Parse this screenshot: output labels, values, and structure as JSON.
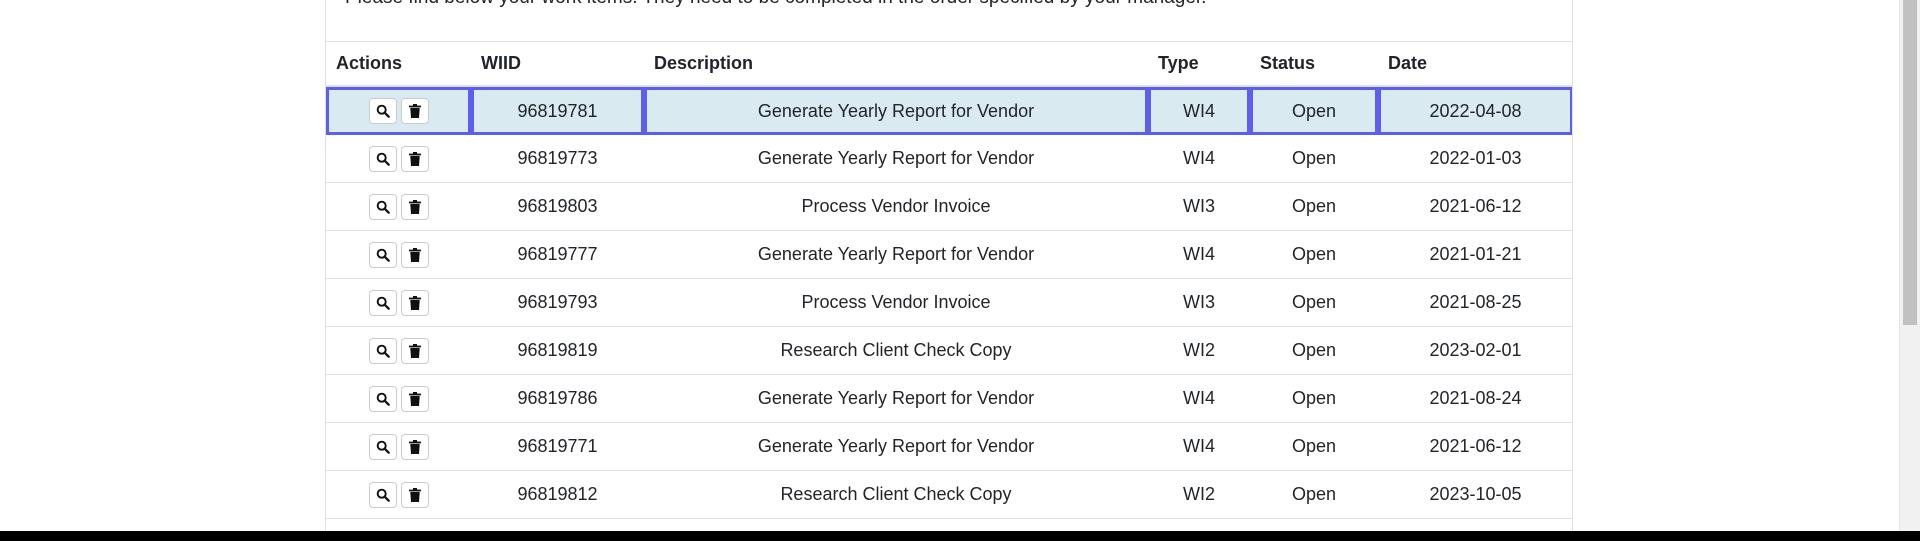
{
  "intro_text": "Please find below your work items. They need to be completed in the order specified by your manager.",
  "table": {
    "headers": {
      "actions": "Actions",
      "wiid": "WIID",
      "description": "Description",
      "type": "Type",
      "status": "Status",
      "date": "Date"
    },
    "rows": [
      {
        "wiid": "96819781",
        "description": "Generate Yearly Report for Vendor",
        "type": "WI4",
        "status": "Open",
        "date": "2022-04-08",
        "selected": true
      },
      {
        "wiid": "96819773",
        "description": "Generate Yearly Report for Vendor",
        "type": "WI4",
        "status": "Open",
        "date": "2022-01-03"
      },
      {
        "wiid": "96819803",
        "description": "Process Vendor Invoice",
        "type": "WI3",
        "status": "Open",
        "date": "2021-06-12"
      },
      {
        "wiid": "96819777",
        "description": "Generate Yearly Report for Vendor",
        "type": "WI4",
        "status": "Open",
        "date": "2021-01-21"
      },
      {
        "wiid": "96819793",
        "description": "Process Vendor Invoice",
        "type": "WI3",
        "status": "Open",
        "date": "2021-08-25"
      },
      {
        "wiid": "96819819",
        "description": "Research Client Check Copy",
        "type": "WI2",
        "status": "Open",
        "date": "2023-02-01"
      },
      {
        "wiid": "96819786",
        "description": "Generate Yearly Report for Vendor",
        "type": "WI4",
        "status": "Open",
        "date": "2021-08-24"
      },
      {
        "wiid": "96819771",
        "description": "Generate Yearly Report for Vendor",
        "type": "WI4",
        "status": "Open",
        "date": "2021-06-12"
      },
      {
        "wiid": "96819812",
        "description": "Research Client Check Copy",
        "type": "WI2",
        "status": "Open",
        "date": "2023-10-05"
      }
    ]
  },
  "row_actions": {
    "view_icon": "magnifier-icon",
    "delete_icon": "trash-icon"
  },
  "colors": {
    "selected_row_bg": "#d9ebf1",
    "selected_row_border": "#5b5ef0",
    "grid_line": "#dee2e6"
  }
}
